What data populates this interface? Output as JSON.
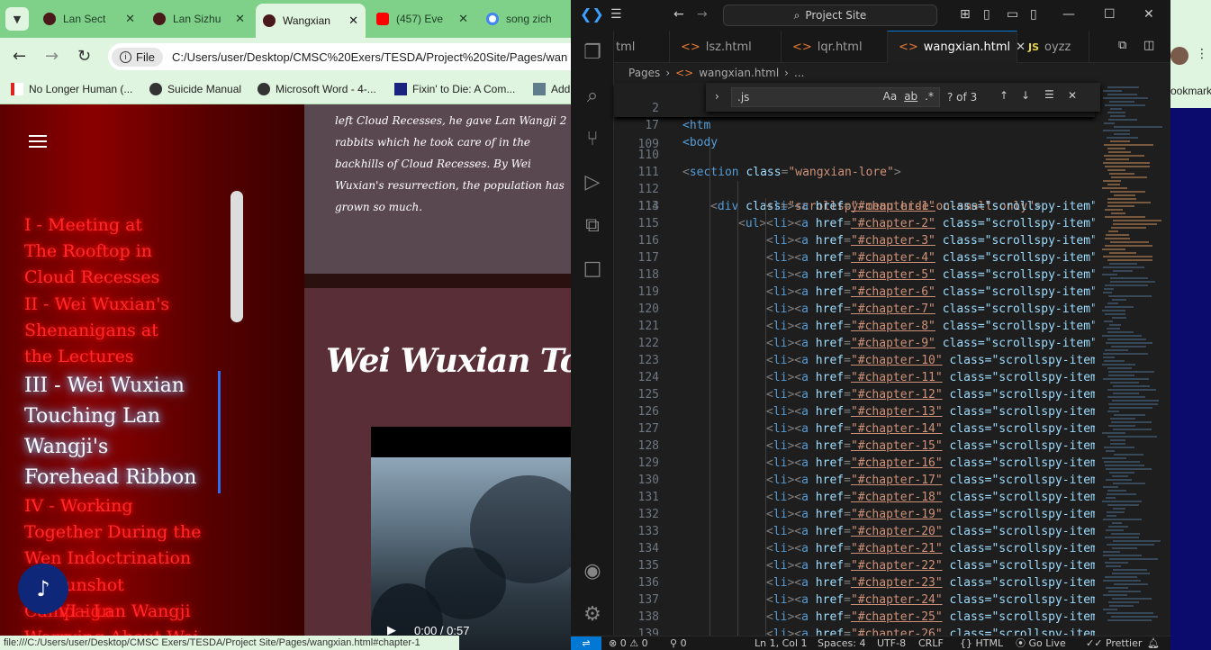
{
  "browser": {
    "tabs": [
      {
        "title": "Lan Sect"
      },
      {
        "title": "Lan Sizhu"
      },
      {
        "title": "Wangxian"
      },
      {
        "title": "(457) Eve"
      },
      {
        "title": "song zich"
      }
    ],
    "address": {
      "scheme_label": "File",
      "url": "C:/Users/user/Desktop/CMSC%20Exers/TESDA/Project%20Site/Pages/wan"
    },
    "bookmarks": [
      {
        "label": "No Longer Human (..."
      },
      {
        "label": "Suicide Manual"
      },
      {
        "label": "Microsoft Word - 4-..."
      },
      {
        "label": "Fixin' to Die: A Com..."
      },
      {
        "label": "Add"
      }
    ],
    "bookmarks_overflow": "ookmark",
    "status_url": "file:///C:/Users/user/Desktop/CMSC Exers/TESDA/Project Site/Pages/wangxian.html#chapter-1"
  },
  "site": {
    "lore_text": "left Cloud Recesses, he gave Lan Wangji 2 rabbits which he took care of in the backhills of Cloud Recesses. By Wei Wuxian's resurrection, the population has grown so much.",
    "chapters": [
      {
        "label": "I - Meeting at The Rooftop in Cloud Recesses",
        "active": false
      },
      {
        "label": "II - Wei Wuxian's Shenanigans at the Lectures",
        "active": false
      },
      {
        "label": "III - Wei Wuxian Touching Lan Wangji's Forehead Ribbon",
        "active": true
      },
      {
        "label": "IV - Working Together During the Wen Indoctrination",
        "active": false
      },
      {
        "label": "V - Sunshot Campaign",
        "active": false
      },
      {
        "label": "VI - Lan Wangji",
        "active": false
      },
      {
        "label": "Worrying About Wei",
        "active": false
      }
    ],
    "chapter_heading": "Wei Wuxian Touchi",
    "video": {
      "time": "0:00 / 0:57"
    }
  },
  "vscode": {
    "search_placeholder": "Project Site",
    "tabs": [
      {
        "name": "tml"
      },
      {
        "name": "lsz.html"
      },
      {
        "name": "lqr.html"
      },
      {
        "name": "wangxian.html",
        "active": true
      },
      {
        "name": "oyzz"
      }
    ],
    "breadcrumb": [
      "Pages",
      "wangxian.html",
      "..."
    ],
    "find": {
      "query": ".js",
      "result": "? of 3"
    },
    "sticky_lines": [
      {
        "num": "2",
        "text": "<htm"
      },
      {
        "num": "17",
        "text": "<body"
      }
    ],
    "line_110": {
      "num": "110",
      "tag": "section",
      "attr": "class",
      "value": "\"wangxian-lore\""
    },
    "line_112": {
      "num": "112",
      "tag": "div",
      "attr": "class",
      "value": "\"scrollspy-menu hide-on-small-only\""
    },
    "line_113": {
      "num": "113",
      "tag": "ul"
    },
    "li_lines": [
      {
        "num": "114",
        "href": "\"#chapter-1\"",
        "cls": "class=\"scrollspy-item\">"
      },
      {
        "num": "115",
        "href": "\"#chapter-2\"",
        "cls": "class=\"scrollspy-item\">"
      },
      {
        "num": "116",
        "href": "\"#chapter-3\"",
        "cls": "class=\"scrollspy-item\">"
      },
      {
        "num": "117",
        "href": "\"#chapter-4\"",
        "cls": "class=\"scrollspy-item\">"
      },
      {
        "num": "118",
        "href": "\"#chapter-5\"",
        "cls": "class=\"scrollspy-item\">"
      },
      {
        "num": "119",
        "href": "\"#chapter-6\"",
        "cls": "class=\"scrollspy-item\">"
      },
      {
        "num": "120",
        "href": "\"#chapter-7\"",
        "cls": "class=\"scrollspy-item\">"
      },
      {
        "num": "121",
        "href": "\"#chapter-8\"",
        "cls": "class=\"scrollspy-item\">"
      },
      {
        "num": "122",
        "href": "\"#chapter-9\"",
        "cls": "class=\"scrollspy-item\">"
      },
      {
        "num": "123",
        "href": "\"#chapter-10\"",
        "cls": "class=\"scrollspy-item\""
      },
      {
        "num": "124",
        "href": "\"#chapter-11\"",
        "cls": "class=\"scrollspy-item\""
      },
      {
        "num": "125",
        "href": "\"#chapter-12\"",
        "cls": "class=\"scrollspy-item\""
      },
      {
        "num": "126",
        "href": "\"#chapter-13\"",
        "cls": "class=\"scrollspy-item\""
      },
      {
        "num": "127",
        "href": "\"#chapter-14\"",
        "cls": "class=\"scrollspy-item\""
      },
      {
        "num": "128",
        "href": "\"#chapter-15\"",
        "cls": "class=\"scrollspy-item\""
      },
      {
        "num": "129",
        "href": "\"#chapter-16\"",
        "cls": "class=\"scrollspy-item\""
      },
      {
        "num": "130",
        "href": "\"#chapter-17\"",
        "cls": "class=\"scrollspy-item\""
      },
      {
        "num": "131",
        "href": "\"#chapter-18\"",
        "cls": "class=\"scrollspy-item\""
      },
      {
        "num": "132",
        "href": "\"#chapter-19\"",
        "cls": "class=\"scrollspy-item\""
      },
      {
        "num": "133",
        "href": "\"#chapter-20\"",
        "cls": "class=\"scrollspy-item\""
      },
      {
        "num": "134",
        "href": "\"#chapter-21\"",
        "cls": "class=\"scrollspy-item\""
      },
      {
        "num": "135",
        "href": "\"#chapter-22\"",
        "cls": "class=\"scrollspy-item\""
      },
      {
        "num": "136",
        "href": "\"#chapter-23\"",
        "cls": "class=\"scrollspy-item\""
      },
      {
        "num": "137",
        "href": "\"#chapter-24\"",
        "cls": "class=\"scrollspy-item\""
      },
      {
        "num": "138",
        "href": "\"#chapter-25\"",
        "cls": "class=\"scrollspy-item\""
      },
      {
        "num": "139",
        "href": "\"#chapter-26\"",
        "cls": "class=\"scrollspy-item\""
      }
    ],
    "status": {
      "errors": "0",
      "warnings": "0",
      "ports": "0",
      "position": "Ln 1, Col 1",
      "spaces": "Spaces: 4",
      "encoding": "UTF-8",
      "eol": "CRLF",
      "language": "HTML",
      "golive": "Go Live",
      "prettier": "Prettier"
    }
  },
  "colors": {
    "chapter_inactive": "#ff2a2a",
    "chapter_active": "#ffffff",
    "vscode_accent": "#0078d4"
  }
}
